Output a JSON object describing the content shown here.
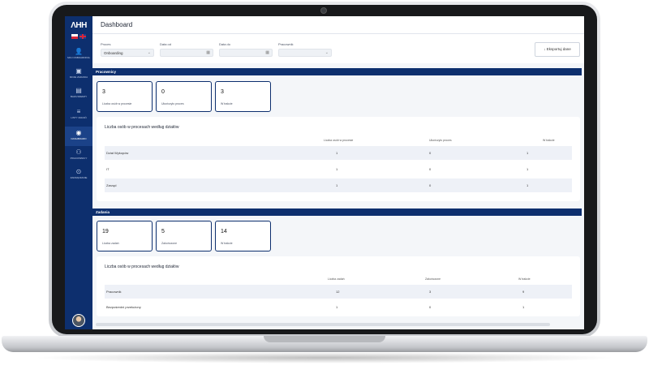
{
  "app": {
    "logo": "ΛΗΗ",
    "page_title": "Dashboard"
  },
  "sidebar": {
    "items": [
      {
        "icon": "user-icon",
        "glyph": "👤",
        "label": "MOJ ONBOARDING"
      },
      {
        "icon": "box-icon",
        "glyph": "▣",
        "label": "MOJE ZADANIA"
      },
      {
        "icon": "book-icon",
        "glyph": "▤",
        "label": "BAZA WIEDZY"
      },
      {
        "icon": "list-icon",
        "glyph": "≡",
        "label": "LISTY ZADAŃ"
      },
      {
        "icon": "dashboard-icon",
        "glyph": "◉",
        "label": "DASHBOARD",
        "active": true
      },
      {
        "icon": "employees-icon",
        "glyph": "⚇",
        "label": "PRACOWNICY"
      },
      {
        "icon": "settings-icon",
        "glyph": "⊙",
        "label": "ZARZĄDZANIE"
      }
    ]
  },
  "filters": {
    "proces_label": "Proces",
    "proces_value": "Onboarding",
    "date_from_label": "Data od",
    "date_to_label": "Data do",
    "employee_label": "Pracownik",
    "export_label": "Eksportuj dane"
  },
  "employees": {
    "section_title": "Pracownicy",
    "cards": [
      {
        "value": "3",
        "label": "Liczba osób w procesie"
      },
      {
        "value": "0",
        "label": "Ukończyło proces"
      },
      {
        "value": "3",
        "label": "W trakcie"
      }
    ],
    "table_title": "Liczba osób w procesach według działów",
    "columns": [
      "Liczba osób w procesie",
      "Ukończyło proces",
      "W trakcie"
    ],
    "rows": [
      {
        "name": "Dział Wykopów",
        "values": [
          "1",
          "0",
          "1"
        ]
      },
      {
        "name": "IT",
        "values": [
          "1",
          "0",
          "1"
        ]
      },
      {
        "name": "Zarząd",
        "values": [
          "1",
          "0",
          "1"
        ]
      }
    ]
  },
  "tasks": {
    "section_title": "Zadania",
    "cards": [
      {
        "value": "19",
        "label": "Liczba zadań"
      },
      {
        "value": "5",
        "label": "Zakończone"
      },
      {
        "value": "14",
        "label": "W trakcie"
      }
    ],
    "table_title": "Liczba osób w procesach według działów",
    "columns": [
      "Liczba zadań",
      "Zakończone",
      "W trakcie"
    ],
    "rows": [
      {
        "name": "Pracownik",
        "values": [
          "12",
          "3",
          "9"
        ]
      },
      {
        "name": "Bezpośredni przełożony",
        "values": [
          "1",
          "0",
          "1"
        ]
      }
    ]
  },
  "colors": {
    "navy": "#0d2f6e",
    "row_alt": "#eef1f7"
  }
}
